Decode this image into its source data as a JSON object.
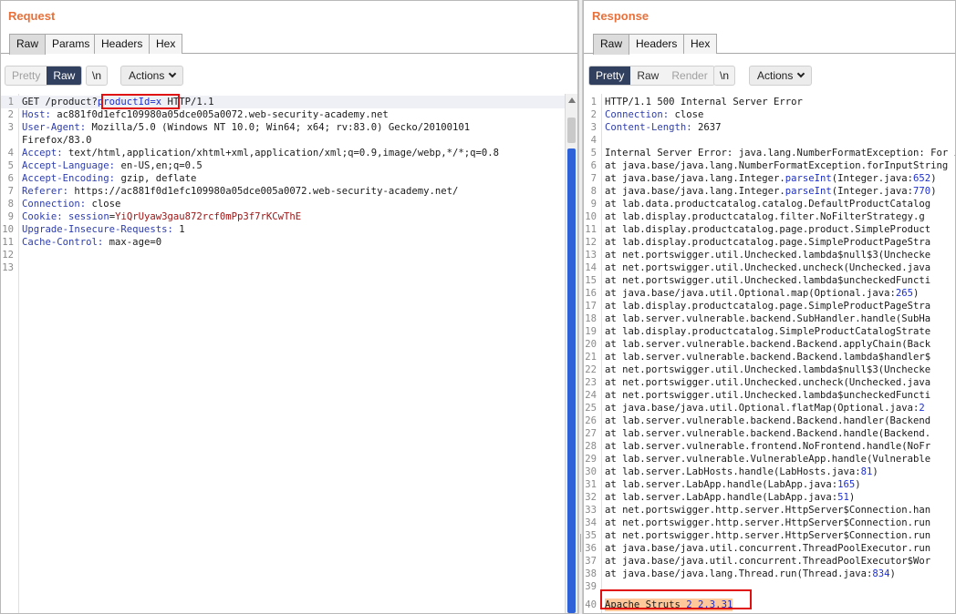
{
  "request": {
    "title": "Request",
    "tabs": [
      "Raw",
      "Params",
      "Headers",
      "Hex"
    ],
    "active_tab": "Raw",
    "toolbar": {
      "pretty": "Pretty",
      "raw": "Raw",
      "newline": "\\n",
      "actions": "Actions"
    },
    "lines": [
      {
        "num": "1",
        "parts": [
          [
            "",
            "GET /product?"
          ],
          [
            "blu",
            "productId=x"
          ],
          [
            "",
            " HTTP/1.1"
          ]
        ]
      },
      {
        "num": "2",
        "parts": [
          [
            "hk",
            "Host:"
          ],
          [
            "",
            " ac881f0d1efc109980a05dce005a0072.web-security-academy.net"
          ]
        ]
      },
      {
        "num": "3",
        "parts": [
          [
            "hk",
            "User-Agent:"
          ],
          [
            "",
            " Mozilla/5.0 (Windows NT 10.0; Win64; x64; rv:83.0) Gecko/20100101"
          ]
        ]
      },
      {
        "num": "",
        "parts": [
          [
            "",
            "Firefox/83.0"
          ]
        ]
      },
      {
        "num": "4",
        "parts": [
          [
            "hk",
            "Accept:"
          ],
          [
            "",
            " text/html,application/xhtml+xml,application/xml;q=0.9,image/webp,*/*;q=0.8"
          ]
        ]
      },
      {
        "num": "5",
        "parts": [
          [
            "hk",
            "Accept-Language:"
          ],
          [
            "",
            " en-US,en;q=0.5"
          ]
        ]
      },
      {
        "num": "6",
        "parts": [
          [
            "hk",
            "Accept-Encoding:"
          ],
          [
            "",
            " gzip, deflate"
          ]
        ]
      },
      {
        "num": "7",
        "parts": [
          [
            "hk",
            "Referer:"
          ],
          [
            "",
            " https://ac881f0d1efc109980a05dce005a0072.web-security-academy.net/"
          ]
        ]
      },
      {
        "num": "8",
        "parts": [
          [
            "hk",
            "Connection:"
          ],
          [
            "",
            " close"
          ]
        ]
      },
      {
        "num": "9",
        "parts": [
          [
            "hk",
            "Cookie:"
          ],
          [
            "",
            " "
          ],
          [
            "hk",
            "session"
          ],
          [
            "",
            "="
          ],
          [
            "ck",
            "YiQrUyaw3gau872rcf0mPp3f7rKCwThE"
          ]
        ]
      },
      {
        "num": "10",
        "parts": [
          [
            "hk",
            "Upgrade-Insecure-Requests:"
          ],
          [
            "",
            " 1"
          ]
        ]
      },
      {
        "num": "11",
        "parts": [
          [
            "hk",
            "Cache-Control:"
          ],
          [
            "",
            " max-age=0"
          ]
        ]
      },
      {
        "num": "12",
        "parts": []
      },
      {
        "num": "13",
        "parts": []
      }
    ]
  },
  "response": {
    "title": "Response",
    "tabs": [
      "Raw",
      "Headers",
      "Hex"
    ],
    "active_tab": "Raw",
    "toolbar": {
      "pretty": "Pretty",
      "raw": "Raw",
      "render": "Render",
      "newline": "\\n",
      "actions": "Actions"
    },
    "lines": [
      {
        "num": "1",
        "parts": [
          [
            "",
            "HTTP/1.1 500 Internal Server Error"
          ]
        ]
      },
      {
        "num": "2",
        "parts": [
          [
            "hk",
            "Connection:"
          ],
          [
            "",
            " close"
          ]
        ]
      },
      {
        "num": "3",
        "parts": [
          [
            "hk",
            "Content-Length:"
          ],
          [
            "",
            " 2637"
          ]
        ]
      },
      {
        "num": "4",
        "parts": []
      },
      {
        "num": "5",
        "parts": [
          [
            "",
            "Internal Server Error: java.lang.NumberFormatException: For input string"
          ]
        ]
      },
      {
        "num": "6",
        "parts": [
          [
            "",
            "at java.base/java.lang.NumberFormatException.forInputString"
          ]
        ]
      },
      {
        "num": "7",
        "parts": [
          [
            "",
            "at java.base/java.lang.Integer."
          ],
          [
            "blu",
            "parseInt"
          ],
          [
            "",
            "(Integer.java:"
          ],
          [
            "blu",
            "652"
          ],
          [
            "",
            ")"
          ]
        ]
      },
      {
        "num": "8",
        "parts": [
          [
            "",
            "at java.base/java.lang.Integer."
          ],
          [
            "blu",
            "parseInt"
          ],
          [
            "",
            "(Integer.java:"
          ],
          [
            "blu",
            "770"
          ],
          [
            "",
            ")"
          ]
        ]
      },
      {
        "num": "9",
        "parts": [
          [
            "",
            "at lab.data.productcatalog.catalog.DefaultProductCatalog"
          ]
        ]
      },
      {
        "num": "10",
        "parts": [
          [
            "",
            "at lab.display.productcatalog.filter.NoFilterStrategy.g"
          ]
        ]
      },
      {
        "num": "11",
        "parts": [
          [
            "",
            "at lab.display.productcatalog.page.product.SimpleProduct"
          ]
        ]
      },
      {
        "num": "12",
        "parts": [
          [
            "",
            "at lab.display.productcatalog.page.SimpleProductPageStra"
          ]
        ]
      },
      {
        "num": "13",
        "parts": [
          [
            "",
            "at net.portswigger.util.Unchecked.lambda$null$3(Unchecke"
          ]
        ]
      },
      {
        "num": "14",
        "parts": [
          [
            "",
            "at net.portswigger.util.Unchecked.uncheck(Unchecked.java"
          ]
        ]
      },
      {
        "num": "15",
        "parts": [
          [
            "",
            "at net.portswigger.util.Unchecked.lambda$uncheckedFuncti"
          ]
        ]
      },
      {
        "num": "16",
        "parts": [
          [
            "",
            "at java.base/java.util.Optional.map(Optional.java:"
          ],
          [
            "blu",
            "265"
          ],
          [
            "",
            ")"
          ]
        ]
      },
      {
        "num": "17",
        "parts": [
          [
            "",
            "at lab.display.productcatalog.page.SimpleProductPageStra"
          ]
        ]
      },
      {
        "num": "18",
        "parts": [
          [
            "",
            "at lab.server.vulnerable.backend.SubHandler.handle(SubHa"
          ]
        ]
      },
      {
        "num": "19",
        "parts": [
          [
            "",
            "at lab.display.productcatalog.SimpleProductCatalogStrate"
          ]
        ]
      },
      {
        "num": "20",
        "parts": [
          [
            "",
            "at lab.server.vulnerable.backend.Backend.applyChain(Back"
          ]
        ]
      },
      {
        "num": "21",
        "parts": [
          [
            "",
            "at lab.server.vulnerable.backend.Backend.lambda$handler$"
          ]
        ]
      },
      {
        "num": "22",
        "parts": [
          [
            "",
            "at net.portswigger.util.Unchecked.lambda$null$3(Unchecke"
          ]
        ]
      },
      {
        "num": "23",
        "parts": [
          [
            "",
            "at net.portswigger.util.Unchecked.uncheck(Unchecked.java"
          ]
        ]
      },
      {
        "num": "24",
        "parts": [
          [
            "",
            "at net.portswigger.util.Unchecked.lambda$uncheckedFuncti"
          ]
        ]
      },
      {
        "num": "25",
        "parts": [
          [
            "",
            "at java.base/java.util.Optional.flatMap(Optional.java:"
          ],
          [
            "blu",
            "2"
          ]
        ]
      },
      {
        "num": "26",
        "parts": [
          [
            "",
            "at lab.server.vulnerable.backend.Backend.handler(Backend"
          ]
        ]
      },
      {
        "num": "27",
        "parts": [
          [
            "",
            "at lab.server.vulnerable.backend.Backend.handle(Backend."
          ]
        ]
      },
      {
        "num": "28",
        "parts": [
          [
            "",
            "at lab.server.vulnerable.frontend.NoFrontend.handle(NoFr"
          ]
        ]
      },
      {
        "num": "29",
        "parts": [
          [
            "",
            "at lab.server.vulnerable.VulnerableApp.handle(Vulnerable"
          ]
        ]
      },
      {
        "num": "30",
        "parts": [
          [
            "",
            "at lab.server.LabHosts.handle(LabHosts.java:"
          ],
          [
            "blu",
            "81"
          ],
          [
            "",
            ")"
          ]
        ]
      },
      {
        "num": "31",
        "parts": [
          [
            "",
            "at lab.server.LabApp.handle(LabApp.java:"
          ],
          [
            "blu",
            "165"
          ],
          [
            "",
            ")"
          ]
        ]
      },
      {
        "num": "32",
        "parts": [
          [
            "",
            "at lab.server.LabApp.handle(LabApp.java:"
          ],
          [
            "blu",
            "51"
          ],
          [
            "",
            ")"
          ]
        ]
      },
      {
        "num": "33",
        "parts": [
          [
            "",
            "at net.portswigger.http.server.HttpServer$Connection.han"
          ]
        ]
      },
      {
        "num": "34",
        "parts": [
          [
            "",
            "at net.portswigger.http.server.HttpServer$Connection.run"
          ]
        ]
      },
      {
        "num": "35",
        "parts": [
          [
            "",
            "at net.portswigger.http.server.HttpServer$Connection.run"
          ]
        ]
      },
      {
        "num": "36",
        "parts": [
          [
            "",
            "at java.base/java.util.concurrent.ThreadPoolExecutor.run"
          ]
        ]
      },
      {
        "num": "37",
        "parts": [
          [
            "",
            "at java.base/java.util.concurrent.ThreadPoolExecutor$Wor"
          ]
        ]
      },
      {
        "num": "38",
        "parts": [
          [
            "",
            "at java.base/java.lang.Thread.run(Thread.java:"
          ],
          [
            "blu",
            "834"
          ],
          [
            "",
            ")"
          ]
        ]
      },
      {
        "num": "39",
        "parts": []
      },
      {
        "num": "40",
        "parts": [
          [
            "",
            "Apache Struts "
          ],
          [
            "blu",
            "2 2.3.31"
          ]
        ]
      }
    ]
  },
  "colors": {
    "title_orange": "#e8703a",
    "active_toggle": "#31405f",
    "header_key": "#2d3dad",
    "cookie_value": "#a01515",
    "highlight_box": "#e01010",
    "struts_highlight": "#ffc89a",
    "scrollbar_rail": "#2e62d8"
  }
}
